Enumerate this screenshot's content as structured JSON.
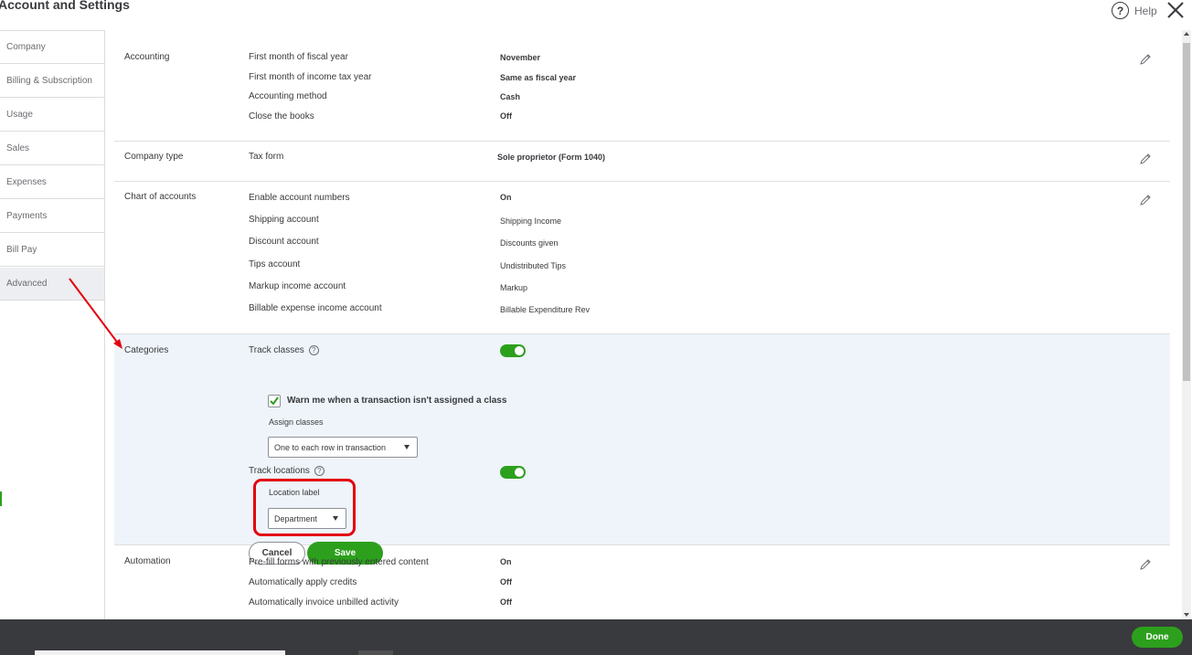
{
  "header": {
    "title": "Account and Settings",
    "help_label": "Help"
  },
  "sidebar": {
    "items": [
      {
        "label": "Company"
      },
      {
        "label": "Billing & Subscription"
      },
      {
        "label": "Usage"
      },
      {
        "label": "Sales"
      },
      {
        "label": "Expenses"
      },
      {
        "label": "Payments"
      },
      {
        "label": "Bill Pay"
      },
      {
        "label": "Advanced"
      }
    ],
    "active": "Advanced"
  },
  "accounting": {
    "title": "Accounting",
    "rows": [
      {
        "label": "First month of fiscal year",
        "value": "November"
      },
      {
        "label": "First month of income tax year",
        "value": "Same as fiscal year"
      },
      {
        "label": "Accounting method",
        "value": "Cash"
      },
      {
        "label": "Close the books",
        "value": "Off"
      }
    ]
  },
  "company_type": {
    "title": "Company type",
    "rows": [
      {
        "label": "Tax form",
        "value": "Sole proprietor (Form 1040)"
      }
    ]
  },
  "chart_of_accounts": {
    "title": "Chart of accounts",
    "rows": [
      {
        "label": "Enable account numbers",
        "value": "On"
      },
      {
        "label": "Shipping account",
        "value": "Shipping Income"
      },
      {
        "label": "Discount account",
        "value": "Discounts given"
      },
      {
        "label": "Tips account",
        "value": "Undistributed Tips"
      },
      {
        "label": "Markup income account",
        "value": "Markup"
      },
      {
        "label": "Billable expense income account",
        "value": "Billable Expenditure Rev"
      }
    ]
  },
  "categories": {
    "title": "Categories",
    "track_classes_label": "Track classes",
    "track_classes_on": true,
    "warn_label": "Warn me when a transaction isn't assigned a class",
    "warn_checked": true,
    "assign_classes_label": "Assign classes",
    "assign_classes_value": "One to each row in transaction",
    "track_locations_label": "Track locations",
    "track_locations_on": true,
    "location_label_label": "Location label",
    "location_label_value": "Department",
    "cancel_label": "Cancel",
    "save_label": "Save"
  },
  "automation": {
    "title": "Automation",
    "rows": [
      {
        "label": "Pre-fill forms with previously entered content",
        "value": "On"
      },
      {
        "label": "Automatically apply credits",
        "value": "Off"
      },
      {
        "label": "Automatically invoice unbilled activity",
        "value": "Off"
      }
    ]
  },
  "footer": {
    "done_label": "Done"
  },
  "colors": {
    "accent_green": "#2ca01c",
    "annotation_red": "#e3000f",
    "footer_bg": "#393a3d",
    "edit_bg": "#eef4fa"
  }
}
